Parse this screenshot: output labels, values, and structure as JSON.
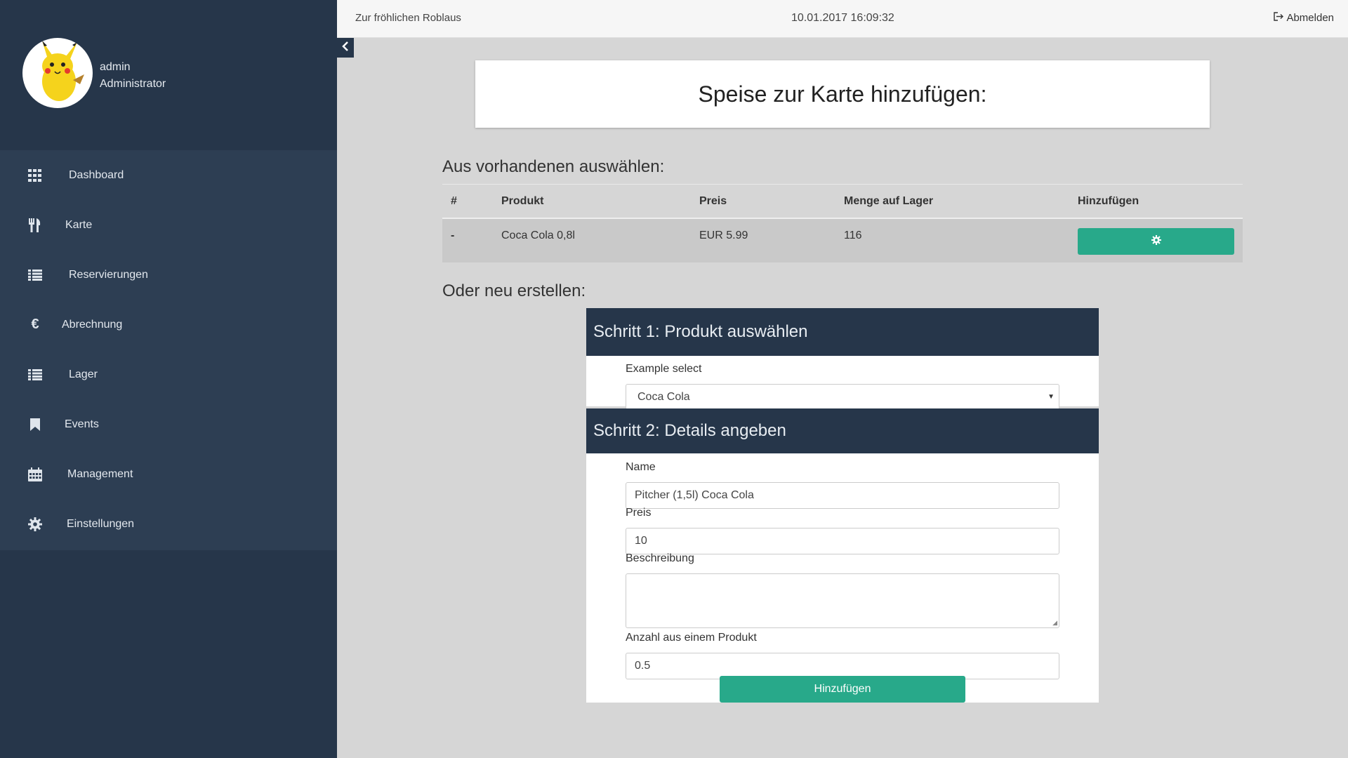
{
  "user": {
    "name": "admin",
    "role": "Administrator"
  },
  "sidebar": {
    "items": [
      {
        "label": "Dashboard",
        "icon": "grid-icon"
      },
      {
        "label": "Karte",
        "icon": "cutlery-icon"
      },
      {
        "label": "Reservierungen",
        "icon": "list-icon"
      },
      {
        "label": "Abrechnung",
        "icon": "euro-icon"
      },
      {
        "label": "Lager",
        "icon": "list-icon"
      },
      {
        "label": "Events",
        "icon": "bookmark-icon"
      },
      {
        "label": "Management",
        "icon": "calendar-icon"
      },
      {
        "label": "Einstellungen",
        "icon": "gear-icon"
      }
    ]
  },
  "topbar": {
    "brand": "Zur fröhlichen Roblaus",
    "datetime": "10.01.2017 16:09:32",
    "logout_label": "Abmelden"
  },
  "page": {
    "title": "Speise zur Karte hinzufügen:",
    "existing_heading": "Aus vorhandenen auswählen:",
    "new_heading": "Oder neu erstellen:"
  },
  "table": {
    "headers": [
      "#",
      "Produkt",
      "Preis",
      "Menge auf Lager",
      "Hinzufügen"
    ],
    "rows": [
      {
        "num": "-",
        "product": "Coca Cola 0,8l",
        "price": "EUR 5.99",
        "stock": "116"
      }
    ]
  },
  "step1": {
    "title": "Schritt 1: Produkt auswählen",
    "select_label": "Example select",
    "select_value": "Coca Cola"
  },
  "step2": {
    "title": "Schritt 2: Details angeben",
    "name_label": "Name",
    "name_value": "Pitcher (1,5l) Coca Cola",
    "price_label": "Preis",
    "price_value": "10",
    "desc_label": "Beschreibung",
    "desc_value": "",
    "qty_label": "Anzahl aus einem Produkt",
    "qty_value": "0.5",
    "submit_label": "Hinzufügen"
  },
  "colors": {
    "sidebar": "#26364a",
    "nav": "#2d3e53",
    "accent": "#28a98a",
    "background": "#d6d6d6"
  }
}
